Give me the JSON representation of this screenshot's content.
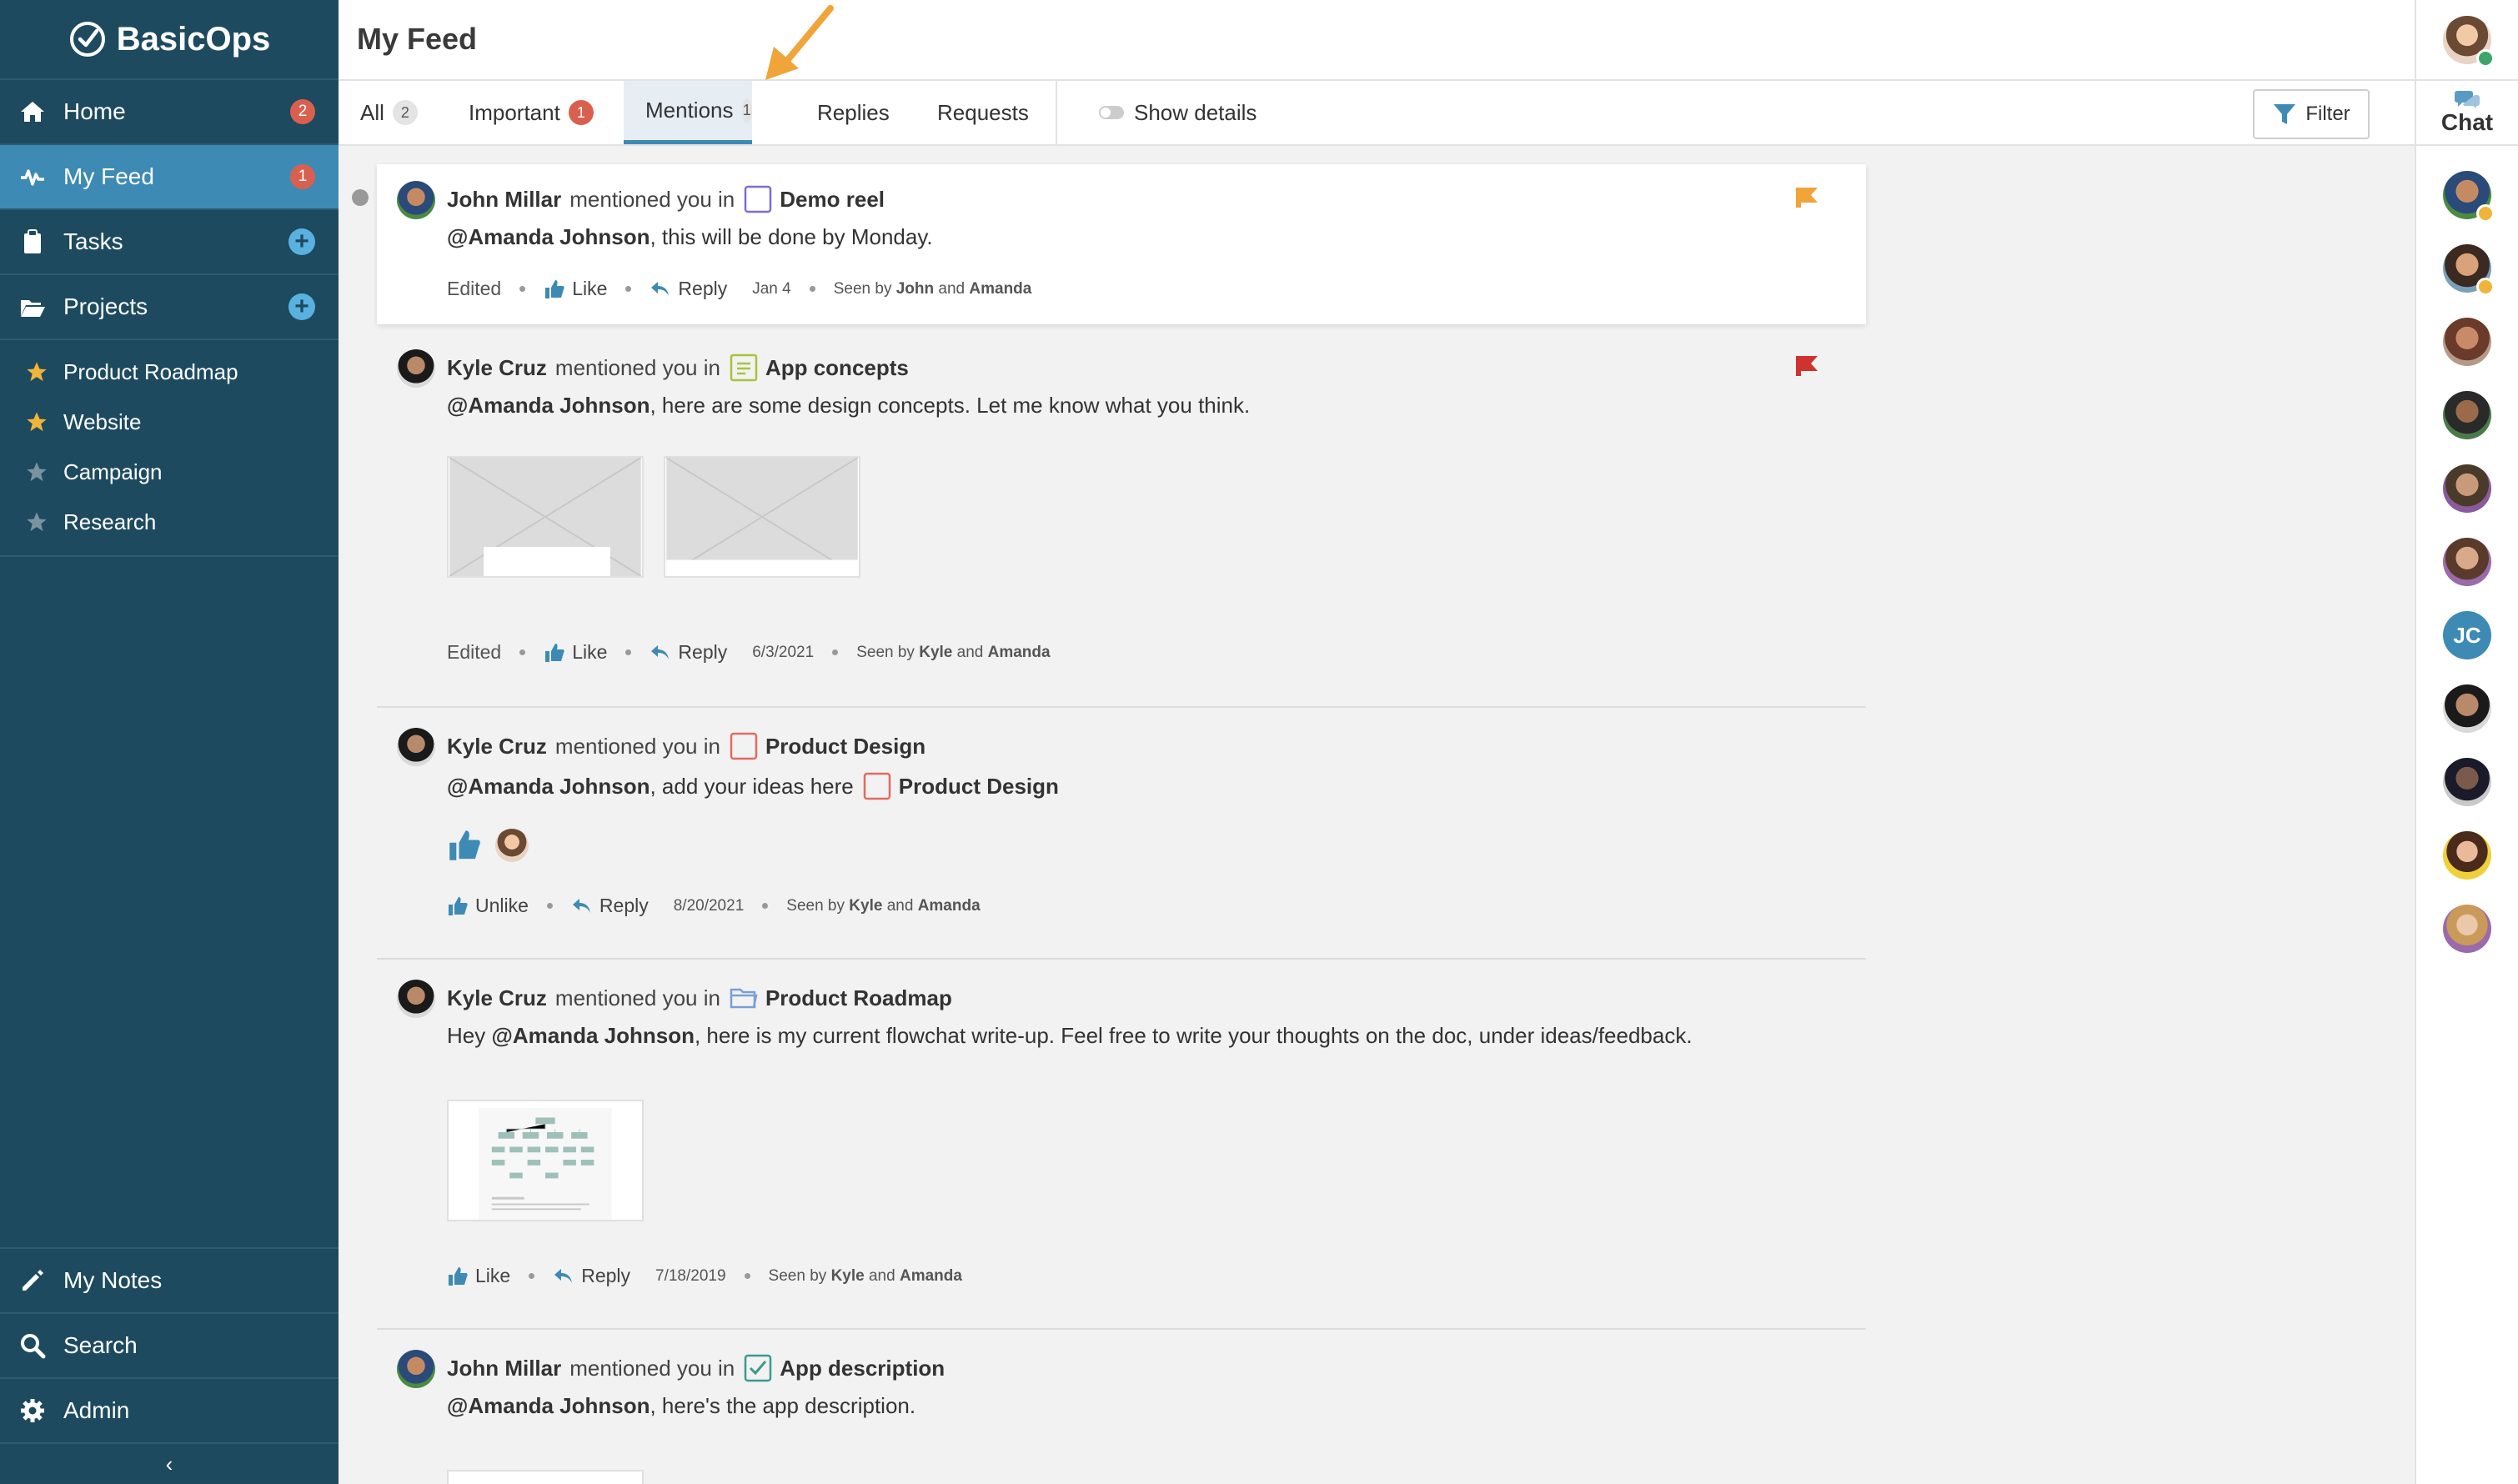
{
  "app": {
    "name": "BasicOps",
    "page_title": "My Feed"
  },
  "sidebar": {
    "nav": [
      {
        "label": "Home",
        "icon": "home-icon",
        "badge": "2"
      },
      {
        "label": "My Feed",
        "icon": "activity-icon",
        "badge": "1"
      },
      {
        "label": "Tasks",
        "icon": "clipboard-icon"
      },
      {
        "label": "Projects",
        "icon": "folder-open-icon"
      }
    ],
    "projects": [
      {
        "label": "Product Roadmap",
        "starred": true
      },
      {
        "label": "Website",
        "starred": true
      },
      {
        "label": "Campaign",
        "starred": false
      },
      {
        "label": "Research",
        "starred": false
      }
    ],
    "bottom": [
      {
        "label": "My Notes",
        "icon": "pencil-icon"
      },
      {
        "label": "Search",
        "icon": "search-icon"
      },
      {
        "label": "Admin",
        "icon": "gear-icon"
      }
    ],
    "collapse_glyph": "‹"
  },
  "tabs": [
    {
      "label": "All",
      "count": "2"
    },
    {
      "label": "Important",
      "count": "1"
    },
    {
      "label": "Mentions",
      "count": "1",
      "active": true
    },
    {
      "label": "Replies"
    },
    {
      "label": "Requests"
    }
  ],
  "show_details_label": "Show details",
  "filter_label": "Filter",
  "chat": {
    "label": "Chat",
    "contacts": [
      {
        "initials": "JC"
      }
    ]
  },
  "colors": {
    "sidebar_bg": "#1d4a5f",
    "active_nav": "#3d8ab5",
    "badge_red": "#d9604f",
    "flag_orange": "#f0a43a",
    "flag_red": "#d0322f",
    "arrow_orange": "#f0a43a"
  },
  "feed": [
    {
      "author": "John Millar",
      "mention_text": "mentioned you in",
      "object": "Demo reel",
      "object_icon": "task-square-icon",
      "mention_name": "@Amanda Johnson",
      "message": ", this will be done by Monday.",
      "edited": "Edited",
      "like_label": "Like",
      "reply_label": "Reply",
      "date": "Jan 4",
      "seen_prefix": "Seen by",
      "seen_a": "John",
      "seen_and": "and",
      "seen_b": "Amanda",
      "flag": "orange",
      "unread": true
    },
    {
      "author": "Kyle Cruz",
      "mention_text": "mentioned you in",
      "object": "App concepts",
      "object_icon": "note-icon",
      "mention_name": "@Amanda Johnson",
      "message": ", here are some design concepts. Let me know what you think.",
      "edited": "Edited",
      "like_label": "Like",
      "reply_label": "Reply",
      "date": "6/3/2021",
      "seen_prefix": "Seen by",
      "seen_a": "Kyle",
      "seen_and": "and",
      "seen_b": "Amanda",
      "flag": "red"
    },
    {
      "author": "Kyle Cruz",
      "mention_text": "mentioned you in",
      "object": "Product Design",
      "object_icon": "task-square-icon",
      "mention_name": "@Amanda Johnson",
      "message": ", add your ideas here",
      "message_object": "Product Design",
      "unlike_label": "Unlike",
      "reply_label": "Reply",
      "date": "8/20/2021",
      "seen_prefix": "Seen by",
      "seen_a": "Kyle",
      "seen_and": "and",
      "seen_b": "Amanda"
    },
    {
      "author": "Kyle Cruz",
      "mention_text": "mentioned you in",
      "object": "Product Roadmap",
      "object_icon": "folder-icon",
      "message_prefix": "Hey",
      "mention_name": "@Amanda Johnson",
      "message": ", here is my current flowchat write-up. Feel free to write your thoughts on the doc, under ideas/feedback.",
      "like_label": "Like",
      "reply_label": "Reply",
      "date": "7/18/2019",
      "seen_prefix": "Seen by",
      "seen_a": "Kyle",
      "seen_and": "and",
      "seen_b": "Amanda"
    },
    {
      "author": "John Millar",
      "mention_text": "mentioned you in",
      "object": "App description",
      "object_icon": "checked-task-icon",
      "mention_name": "@Amanda Johnson",
      "message": ", here's the app description."
    }
  ]
}
